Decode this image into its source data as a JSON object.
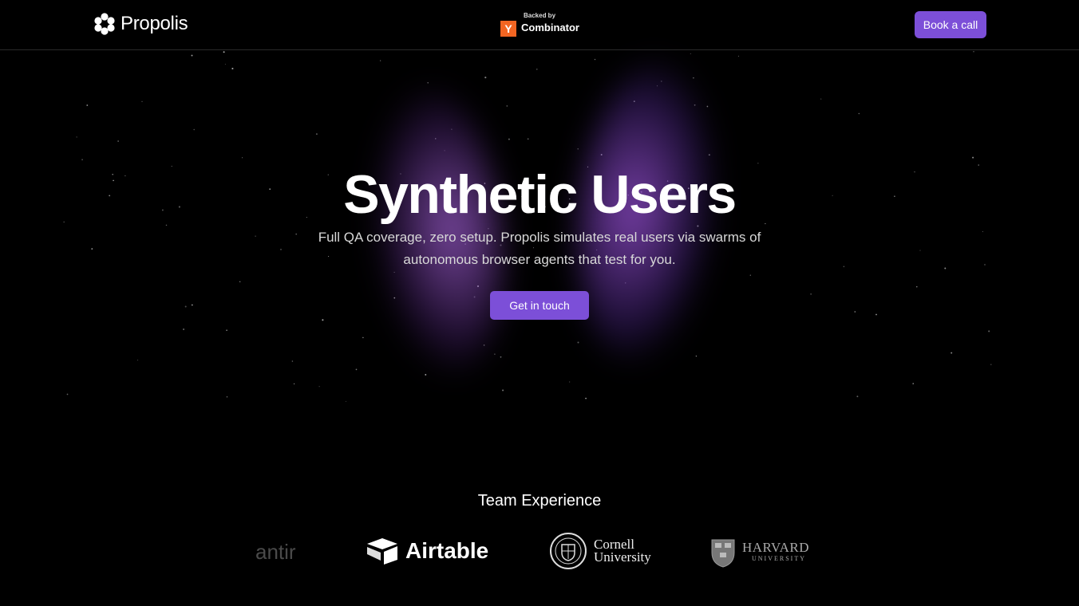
{
  "header": {
    "brand": "Propolis",
    "yc_backed": "Backed by",
    "yc_mark": "Y",
    "yc_name": "Combinator",
    "book_button": "Book a call"
  },
  "hero": {
    "title": "Synthetic Users",
    "subtitle_line1": "Full QA coverage, zero setup. Propolis simulates real users via swarms of",
    "subtitle_line2": "autonomous browser agents that test for you.",
    "cta": "Get in touch"
  },
  "team": {
    "title": "Team Experience",
    "logos": {
      "palantir": "antir",
      "airtable": "Airtable",
      "cornell_line1": "Cornell",
      "cornell_line2": "University",
      "harvard_line1": "HARVARD",
      "harvard_line2": "UNIVERSITY"
    }
  },
  "colors": {
    "accent": "#7c4fd8",
    "yc_orange": "#f26522",
    "background": "#000000"
  }
}
